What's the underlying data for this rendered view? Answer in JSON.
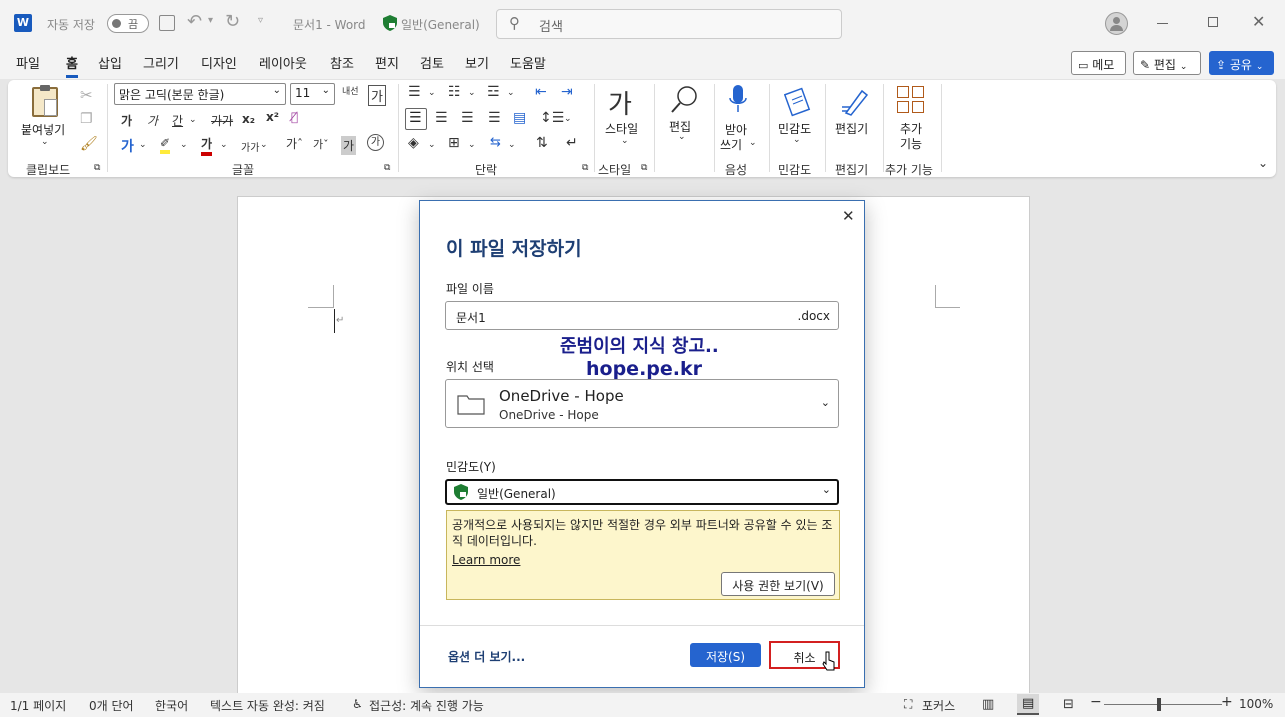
{
  "titlebar": {
    "autosave_label": "자동 저장",
    "autosave_state": "끔",
    "doc_title": "문서1  -  Word",
    "sensitivity": "일반(General)",
    "search_placeholder": "검색"
  },
  "menu": {
    "tabs": [
      "파일",
      "홈",
      "삽입",
      "그리기",
      "디자인",
      "레이아웃",
      "참조",
      "편지",
      "검토",
      "보기",
      "도움말"
    ],
    "memo": "메모",
    "edit": "편집",
    "share": "공유"
  },
  "ribbon": {
    "paste": "붙여넣기",
    "font_name": "맑은 고딕(본문 한글)",
    "font_size": "11",
    "style": "스타일",
    "editing": "편집",
    "dictate_1": "받아",
    "dictate_2": "쓰기",
    "sensitivity": "민감도",
    "editor": "편집기",
    "addins_1": "추가",
    "addins_2": "기능",
    "groups": {
      "clipboard": "클립보드",
      "font": "글꼴",
      "paragraph": "단락",
      "styles": "스타일",
      "voice": "음성",
      "sensitivity": "민감도",
      "editor": "편집기",
      "addins": "추가 기능"
    }
  },
  "dialog": {
    "title": "이 파일 저장하기",
    "filename_label": "파일 이름",
    "filename_value": "문서1",
    "extension": ".docx",
    "watermark_line1": "준범이의 지식 창고..",
    "watermark_line2": "hope.pe.kr",
    "location_label": "위치 선택",
    "location_primary": "OneDrive - Hope",
    "location_secondary": "OneDrive - Hope",
    "sensitivity_label": "민감도(Y)",
    "sensitivity_value": "일반(General)",
    "info_text": "공개적으로 사용되지는 않지만 적절한 경우 외부 파트너와 공유할 수 있는 조직 데이터입니다.",
    "learn_more": "Learn more",
    "view_permissions": "사용 권한 보기(V)",
    "more_options": "옵션 더 보기...",
    "save": "저장(S)",
    "cancel": "취소"
  },
  "statusbar": {
    "page": "1/1 페이지",
    "words": "0개 단어",
    "language": "한국어",
    "autocomplete": "텍스트 자동 완성: 켜짐",
    "accessibility": "접근성: 계속 진행 가능",
    "focus": "포커스",
    "zoom": "100%"
  },
  "colors": {
    "accent": "#2564cf",
    "dialog_title": "#1e3f74",
    "cancel_highlight": "#d32020",
    "info_bg": "#fdf6cc",
    "sensitivity_green": "#1e7d32"
  }
}
